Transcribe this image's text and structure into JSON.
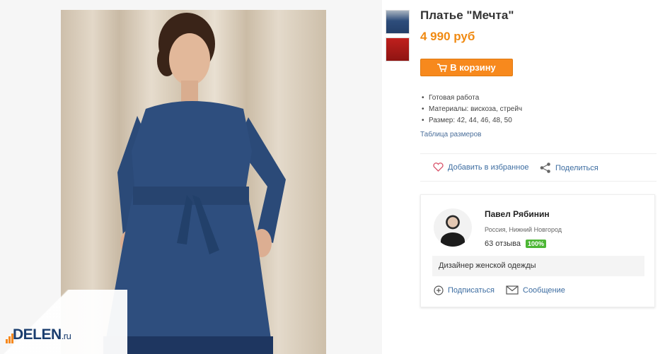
{
  "product": {
    "title": "Платье \"Мечта\"",
    "price": "4 990 руб",
    "cart_label": "В корзину",
    "features": [
      "Готовая работа",
      "Материалы:  вискоза, стрейч",
      "Размер: 42, 44, 46, 48, 50"
    ],
    "size_table_link": "Таблица размеров"
  },
  "actions": {
    "favorite_label": "Добавить в избранное",
    "share_label": "Поделиться"
  },
  "seller": {
    "name": "Павел Рябинин",
    "location": "Россия, Нижний Новгород",
    "reviews": "63 отзыва",
    "rating_badge": "100%",
    "description": "Дизайнер женской одежды",
    "subscribe_label": "Подписаться",
    "message_label": "Сообщение"
  },
  "logo": {
    "text": "DELEN",
    "suffix": ".ru"
  },
  "colors": {
    "accent": "#f7891d",
    "price": "#f08a12",
    "link": "#3d6da1",
    "badge": "#4cb634",
    "dress": "#2a4a78"
  },
  "icons": [
    "cart-icon",
    "heart-icon",
    "share-icon",
    "plus-circle-icon",
    "envelope-icon"
  ]
}
